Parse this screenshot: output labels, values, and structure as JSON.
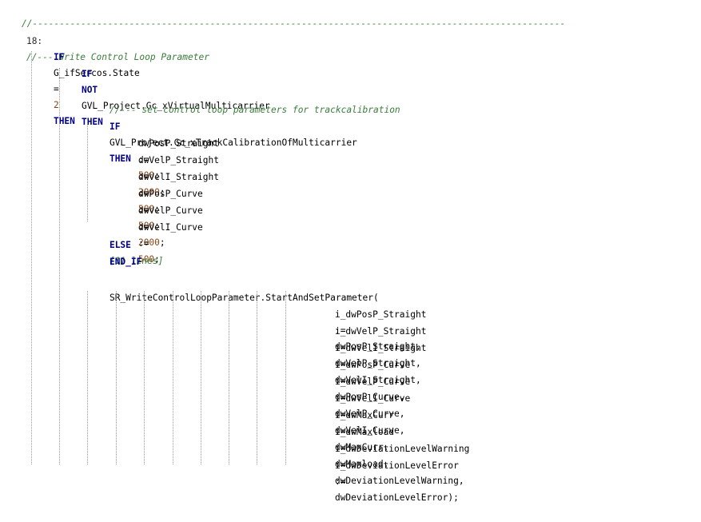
{
  "editor": {
    "separator": "//---------------------------------------------------------------------------------------------------",
    "header": {
      "num": "18:",
      "comment": "//--- Write Control Loop Parameter"
    },
    "if_sercos": {
      "kw1": "IF",
      "expr": "G_ifSercos.State := 2",
      "expr_id": "G_ifSercos.State",
      "expr_op": "=",
      "expr_num": "2",
      "kw2": "THEN"
    },
    "if_not": {
      "kw1": "IF",
      "kw2": "NOT",
      "expr": "GVL_Project.Gc_xVirtualMulticarrier",
      "kw3": "THEN"
    },
    "comment_track": "//--- set control loop parameters for trackcalibration",
    "if_track": {
      "kw1": "IF",
      "expr": "GVL_Project.Gc_xTrackCalibrationOfMulticarrier",
      "kw2": "THEN"
    },
    "assignments": [
      {
        "lhs": "dwPosP_Straight",
        "op": ":=",
        "value": "500"
      },
      {
        "lhs": "dwVelP_Straight",
        "op": ":=",
        "value": "2000"
      },
      {
        "lhs": "dwVelI_Straight",
        "op": ":=",
        "value": "500"
      },
      {
        "lhs": "dwPosP_Curve   ",
        "op": ":=",
        "value": "500"
      },
      {
        "lhs": "dwVelP_Curve   ",
        "op": ":=",
        "value": "2000"
      },
      {
        "lhs": "dwVelI_Curve   ",
        "op": ":=",
        "value": "500"
      }
    ],
    "else": {
      "kw": "ELSE",
      "collapsed": "[11 lines]"
    },
    "end_if": "END_IF",
    "call": "SR_WriteControlLoopParameter.StartAndSetParameter(",
    "params": [
      {
        "name": "i_dwPosP_Straight  ",
        "op": ":=",
        "value": "dwPosP_Straight,"
      },
      {
        "name": "i_dwVelP_Straight  ",
        "op": ":=",
        "value": "dwVelP_Straight,"
      },
      {
        "name": "i_dwVelI_Straight  ",
        "op": ":=",
        "value": "dwVelI_Straight,"
      },
      {
        "name": "i_dwPosP_Curve     ",
        "op": ":=",
        "value": "dwPosP_Curve,"
      },
      {
        "name": "i_dwVelP_Curve     ",
        "op": ":=",
        "value": "dwVelP_Curve,"
      },
      {
        "name": "i_dwVelI_Curve     ",
        "op": ":=",
        "value": "dwVelI_Curve,"
      },
      {
        "name": "i_dwMaxCurr        ",
        "op": ":=",
        "value": "dwMaxCurr,"
      },
      {
        "name": "i_dwMaxload        ",
        "op": ":=",
        "value": "dwMaxload,"
      },
      {
        "name": "i_dwDeviationLevelWarning   ",
        "op": ":=",
        "value": "dwDeviationLevelWarning,"
      },
      {
        "name": "i_dwDeviationLevelError     ",
        "op": ":=",
        "value": "dwDeviationLevelError);"
      }
    ]
  },
  "colors": {
    "comment": "#3b7d3b",
    "keyword": "#00008b",
    "number": "#8b4513",
    "background": "#ffffff"
  }
}
